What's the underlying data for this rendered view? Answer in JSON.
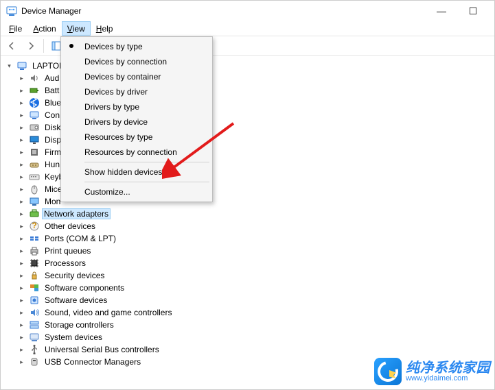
{
  "window": {
    "title": "Device Manager",
    "min": "—",
    "max": "☐",
    "close": "✕"
  },
  "menubar": {
    "items": [
      "File",
      "Action",
      "View",
      "Help"
    ],
    "open_index": 2
  },
  "view_menu": {
    "items": [
      {
        "label": "Devices by type",
        "checked": true
      },
      {
        "label": "Devices by connection"
      },
      {
        "label": "Devices by container"
      },
      {
        "label": "Devices by driver"
      },
      {
        "label": "Drivers by type"
      },
      {
        "label": "Drivers by device"
      },
      {
        "label": "Resources by type"
      },
      {
        "label": "Resources by connection"
      },
      {
        "sep": true
      },
      {
        "label": "Show hidden devices"
      },
      {
        "sep": true
      },
      {
        "label": "Customize..."
      }
    ]
  },
  "tree": {
    "root_label": "LAPTOP",
    "selected_index": 12,
    "children": [
      {
        "icon": "audio",
        "label": "Aud"
      },
      {
        "icon": "battery",
        "label": "Batt"
      },
      {
        "icon": "bluetooth",
        "label": "Blue"
      },
      {
        "icon": "computer",
        "label": "Con"
      },
      {
        "icon": "disk",
        "label": "Disk"
      },
      {
        "icon": "display",
        "label": "Disp"
      },
      {
        "icon": "firmware",
        "label": "Firm"
      },
      {
        "icon": "hid",
        "label": "Hun"
      },
      {
        "icon": "keyboard",
        "label": "Keyb"
      },
      {
        "icon": "mouse",
        "label": "Mice"
      },
      {
        "icon": "monitor",
        "label": "Mon"
      },
      {
        "icon": "network",
        "label": "Network adapters"
      },
      {
        "icon": "other",
        "label": "Other devices"
      },
      {
        "icon": "ports",
        "label": "Ports (COM & LPT)"
      },
      {
        "icon": "print",
        "label": "Print queues"
      },
      {
        "icon": "processor",
        "label": "Processors"
      },
      {
        "icon": "security",
        "label": "Security devices"
      },
      {
        "icon": "swcomp",
        "label": "Software components"
      },
      {
        "icon": "swdev",
        "label": "Software devices"
      },
      {
        "icon": "sound",
        "label": "Sound, video and game controllers"
      },
      {
        "icon": "storage",
        "label": "Storage controllers"
      },
      {
        "icon": "system",
        "label": "System devices"
      },
      {
        "icon": "usb",
        "label": "Universal Serial Bus controllers"
      },
      {
        "icon": "usbconn",
        "label": "USB Connector Managers"
      }
    ]
  },
  "watermark": {
    "brand": "纯净系统家园",
    "url": "www.yidaimei.com"
  }
}
